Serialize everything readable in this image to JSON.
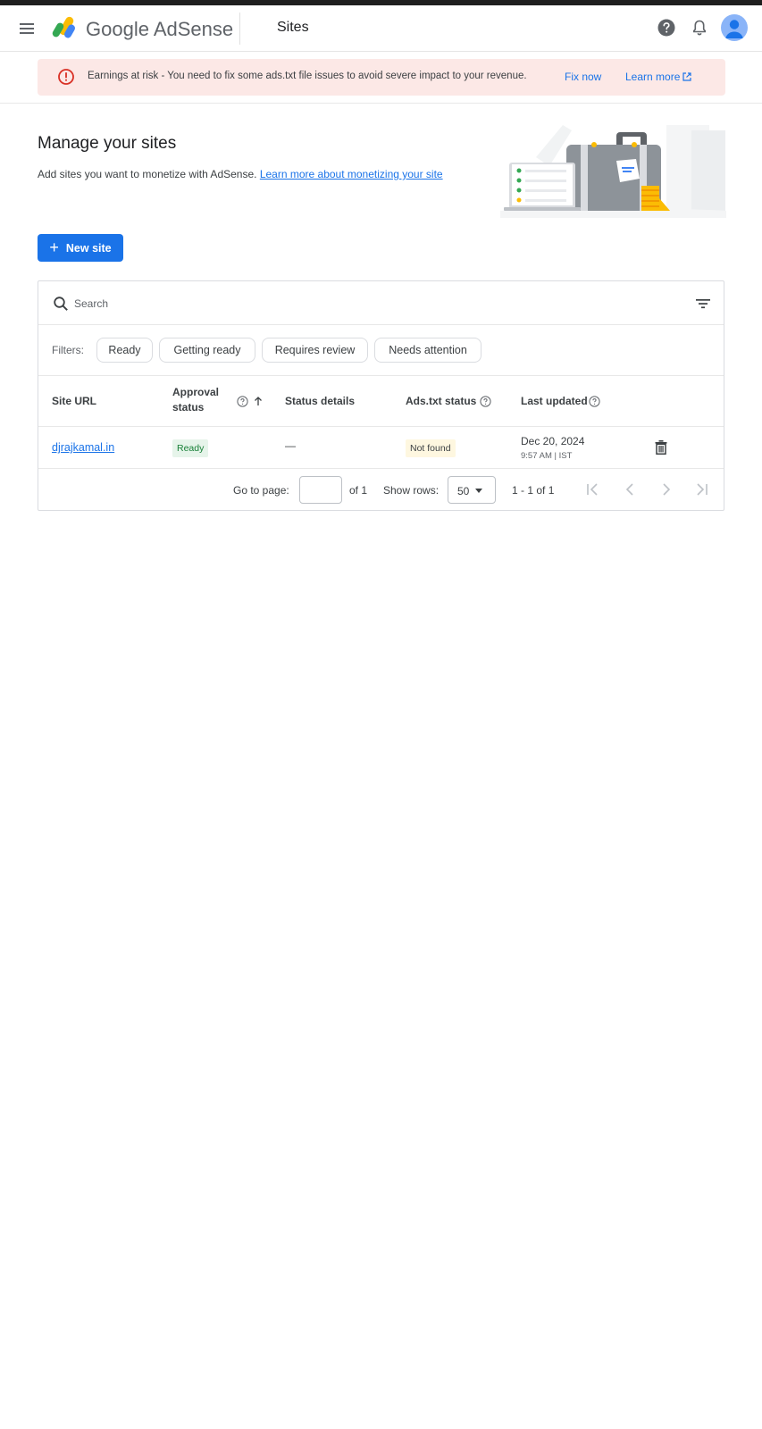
{
  "app": {
    "brand": "Google AdSense",
    "page_name": "Sites"
  },
  "alert": {
    "text": "Earnings at risk - You need to fix some ads.txt file issues to avoid severe impact to your revenue.",
    "fix_label": "Fix now",
    "learn_label": "Learn more"
  },
  "header": {
    "title": "Manage your sites",
    "subtitle": "Add sites you want to monetize with AdSense.",
    "subtitle_link": "Learn more about monetizing your site",
    "new_site_label": "New site"
  },
  "table": {
    "search_placeholder": "Search",
    "filters_label": "Filters:",
    "filters": [
      "Ready",
      "Getting ready",
      "Requires review",
      "Needs attention"
    ],
    "columns": {
      "site_url": "Site URL",
      "approval_status_line1": "Approval",
      "approval_status_line2": "status",
      "status_details": "Status details",
      "ads_txt_status": "Ads.txt status",
      "last_updated": "Last updated"
    },
    "rows": [
      {
        "site_url": "djrajkamal.in",
        "approval_status": "Ready",
        "status_details": "—",
        "ads_txt_status": "Not found",
        "last_updated_date": "Dec 20, 2024",
        "last_updated_time": "9:57 AM | IST"
      }
    ],
    "pager": {
      "go_to_page_label": "Go to page:",
      "of_pages": "of 1",
      "show_rows_label": "Show rows:",
      "rows_value": "50",
      "range": "1 - 1 of 1"
    }
  },
  "colors": {
    "accent": "#1a73e8",
    "alert_bg": "#fce8e6",
    "alert_icon": "#d93025",
    "ready_bg": "#e6f4ea",
    "ready_text": "#188038",
    "notfound_bg": "#fef7e0"
  },
  "icons": {
    "menu": "menu-icon",
    "help": "help-icon",
    "bell": "bell-icon",
    "avatar": "avatar",
    "alert": "error-icon",
    "external": "open-in-new-icon",
    "search": "search-icon",
    "filter": "filter-icon",
    "trash": "trash-icon"
  }
}
